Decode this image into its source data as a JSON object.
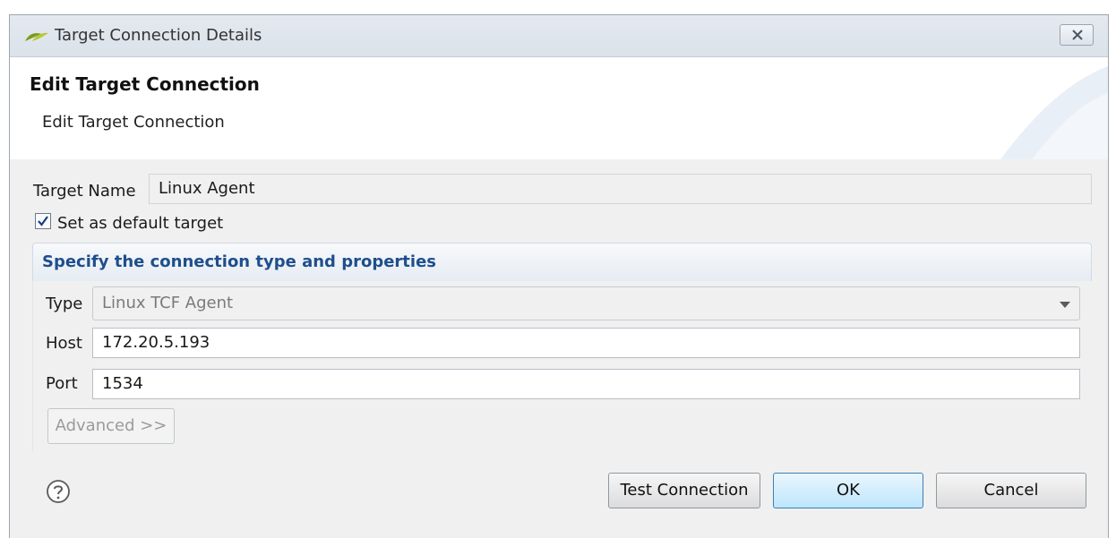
{
  "window": {
    "title": "Target Connection Details",
    "icons": {
      "app": "eclipse-leaf-icon",
      "close": "close-icon"
    }
  },
  "banner": {
    "title": "Edit Target Connection",
    "subtitle": "Edit Target Connection"
  },
  "form": {
    "target_name_label": "Target Name",
    "target_name_value": "Linux Agent",
    "default_checkbox_label": "Set as default target",
    "default_checked": true
  },
  "group": {
    "title": "Specify the connection type and properties",
    "type_label": "Type",
    "type_value": "Linux TCF Agent",
    "host_label": "Host",
    "host_value": "172.20.5.193",
    "port_label": "Port",
    "port_value": "1534",
    "advanced_label": "Advanced >>"
  },
  "buttons": {
    "test_connection": "Test Connection",
    "ok": "OK",
    "cancel": "Cancel",
    "help_icon": "help-icon"
  },
  "colors": {
    "accent": "#1f4e8c",
    "default_button": "#bee6fd"
  }
}
